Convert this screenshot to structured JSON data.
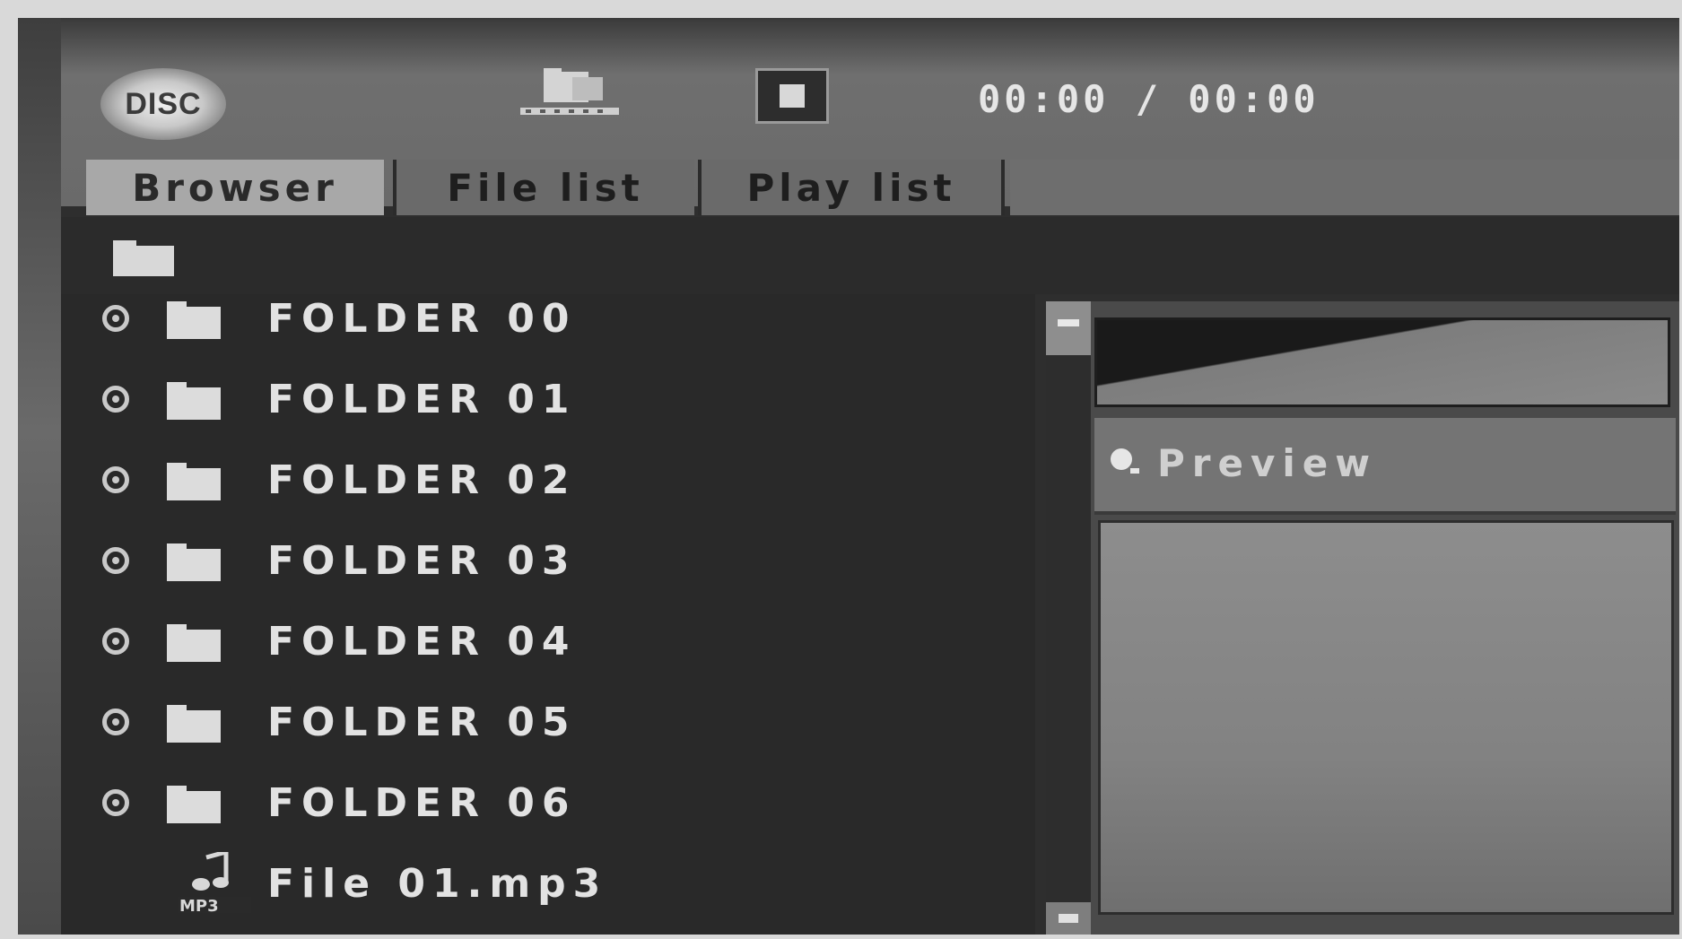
{
  "header": {
    "logo_text": "DISC",
    "time": "00:00 / 00:00"
  },
  "tabs": [
    {
      "label": "Browser",
      "active": true
    },
    {
      "label": "File list",
      "active": false
    },
    {
      "label": "Play list",
      "active": false
    }
  ],
  "list": {
    "items": [
      {
        "type": "folder",
        "label": "FOLDER 00"
      },
      {
        "type": "folder",
        "label": "FOLDER 01"
      },
      {
        "type": "folder",
        "label": "FOLDER 02"
      },
      {
        "type": "folder",
        "label": "FOLDER 03"
      },
      {
        "type": "folder",
        "label": "FOLDER 04"
      },
      {
        "type": "folder",
        "label": "FOLDER 05"
      },
      {
        "type": "folder",
        "label": "FOLDER 06"
      },
      {
        "type": "file",
        "label": "File 01.mp3"
      }
    ]
  },
  "preview": {
    "label": "Preview"
  },
  "icons": {
    "logo": "disc-logo",
    "media": "media-folder-icon",
    "stop": "stop-icon",
    "path": "folder-icon",
    "expand": "expand-icon",
    "folder": "folder-icon",
    "file": "mp3-file-icon",
    "preview": "preview-icon"
  },
  "colors": {
    "background": "#2e2e2e",
    "tab_active": "#a8a8a8",
    "tab_inactive": "#6a6a6a",
    "text": "#e2e2e2"
  }
}
